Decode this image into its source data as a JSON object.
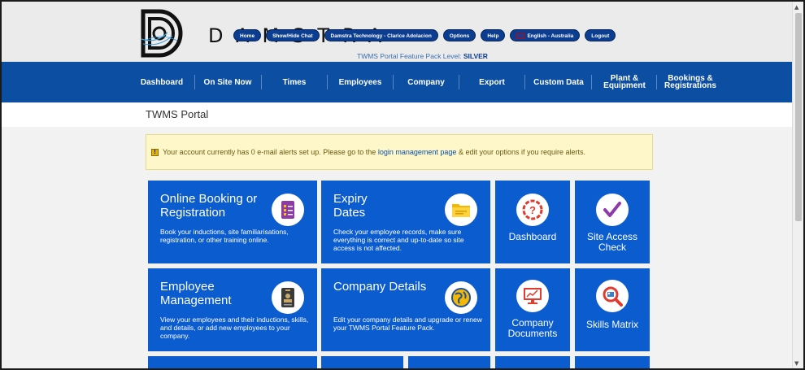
{
  "brand": {
    "name": "DAMSTRA"
  },
  "top_buttons": [
    {
      "label": "Home"
    },
    {
      "label": "Show/Hide Chat"
    },
    {
      "label": "Damstra Technology - Clarice Adolacion"
    },
    {
      "label": "Options"
    },
    {
      "label": "Help"
    },
    {
      "label": "English - Australia",
      "flag": "au-flag-icon"
    },
    {
      "label": "Logout"
    }
  ],
  "feature_level": {
    "prefix": "TWMS Portal Feature Pack Level:",
    "value": "SILVER"
  },
  "nav": [
    {
      "label": "Dashboard"
    },
    {
      "label": "On Site Now"
    },
    {
      "label": "Times"
    },
    {
      "label": "Employees"
    },
    {
      "label": "Company"
    },
    {
      "label": "Export"
    },
    {
      "label": "Custom Data"
    },
    {
      "label": "Plant & Equipment"
    },
    {
      "label": "Bookings & Registrations"
    }
  ],
  "page_title": "TWMS Portal",
  "alert": {
    "before": "Your account currently has 0 e-mail alerts set up. Please go to the",
    "link": "login management page",
    "after": "& edit your options if you require alerts."
  },
  "tiles": {
    "online_booking": {
      "title": "Online Booking or Registration",
      "desc": "Book your inductions, site familiarisations, registration, or other training online.",
      "icon": "checklist-icon"
    },
    "expiry_dates": {
      "title": "Expiry Dates",
      "desc": "Check your employee records, make sure everything is correct and up-to-date so site access is not affected.",
      "icon": "folder-icon"
    },
    "dashboard": {
      "label": "Dashboard",
      "icon": "question-dial-icon"
    },
    "site_access": {
      "label": "Site Access Check",
      "icon": "checkmark-icon"
    },
    "employee_mgmt": {
      "title": "Employee Management",
      "desc": "View your employees and their inductions, skills, and details, or add new employees to your company.",
      "icon": "id-badge-icon"
    },
    "company_details": {
      "title": "Company Details",
      "desc": "Edit your company details and upgrade or renew your TWMS Portal Feature Pack.",
      "icon": "globe-icon"
    },
    "company_documents": {
      "label": "Company Documents",
      "icon": "monitor-chart-icon"
    },
    "skills_matrix": {
      "label": "Skills Matrix",
      "icon": "magnifier-id-icon"
    }
  },
  "colors": {
    "nav_blue": "#0b4ea2",
    "tile_blue": "#0b5ccf",
    "pill_blue": "#0b3d91",
    "alert_bg": "#fdf7c9"
  }
}
